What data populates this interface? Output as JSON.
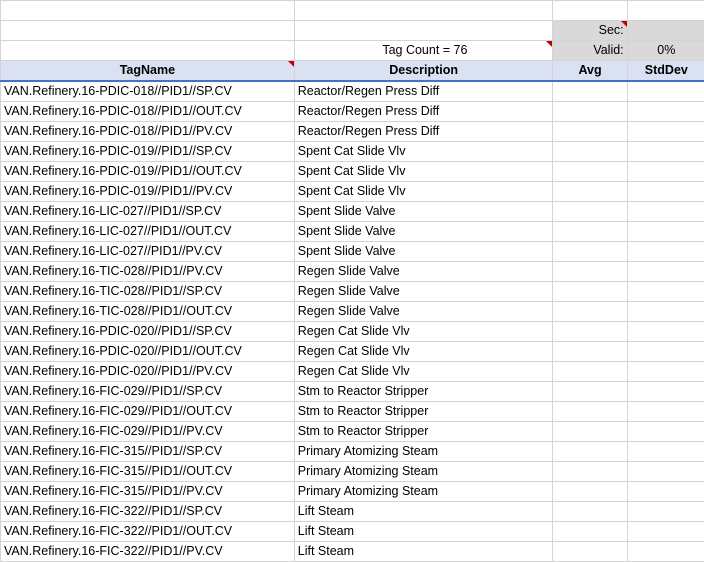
{
  "header": {
    "sec_label": "Sec:",
    "sec_value": "",
    "tag_count": "Tag Count = 76",
    "valid_label": "Valid:",
    "valid_value": "0%"
  },
  "columns": [
    "TagName",
    "Description",
    "Avg",
    "StdDev"
  ],
  "rows": [
    [
      "VAN.Refinery.16-PDIC-018//PID1//SP.CV",
      "Reactor/Regen Press Diff"
    ],
    [
      "VAN.Refinery.16-PDIC-018//PID1//OUT.CV",
      "Reactor/Regen Press Diff"
    ],
    [
      "VAN.Refinery.16-PDIC-018//PID1//PV.CV",
      "Reactor/Regen Press Diff"
    ],
    [
      "VAN.Refinery.16-PDIC-019//PID1//SP.CV",
      "Spent Cat Slide Vlv"
    ],
    [
      "VAN.Refinery.16-PDIC-019//PID1//OUT.CV",
      "Spent Cat Slide Vlv"
    ],
    [
      "VAN.Refinery.16-PDIC-019//PID1//PV.CV",
      "Spent Cat Slide Vlv"
    ],
    [
      "VAN.Refinery.16-LIC-027//PID1//SP.CV",
      "Spent Slide Valve"
    ],
    [
      "VAN.Refinery.16-LIC-027//PID1//OUT.CV",
      "Spent Slide Valve"
    ],
    [
      "VAN.Refinery.16-LIC-027//PID1//PV.CV",
      "Spent Slide Valve"
    ],
    [
      "VAN.Refinery.16-TIC-028//PID1//PV.CV",
      "Regen Slide Valve"
    ],
    [
      "VAN.Refinery.16-TIC-028//PID1//SP.CV",
      "Regen Slide Valve"
    ],
    [
      "VAN.Refinery.16-TIC-028//PID1//OUT.CV",
      "Regen Slide Valve"
    ],
    [
      "VAN.Refinery.16-PDIC-020//PID1//SP.CV",
      "Regen Cat Slide Vlv"
    ],
    [
      "VAN.Refinery.16-PDIC-020//PID1//OUT.CV",
      "Regen Cat Slide Vlv"
    ],
    [
      "VAN.Refinery.16-PDIC-020//PID1//PV.CV",
      "Regen Cat Slide Vlv"
    ],
    [
      "VAN.Refinery.16-FIC-029//PID1//SP.CV",
      "Stm to Reactor Stripper"
    ],
    [
      "VAN.Refinery.16-FIC-029//PID1//OUT.CV",
      "Stm to Reactor Stripper"
    ],
    [
      "VAN.Refinery.16-FIC-029//PID1//PV.CV",
      "Stm to Reactor Stripper"
    ],
    [
      "VAN.Refinery.16-FIC-315//PID1//SP.CV",
      "Primary Atomizing Steam"
    ],
    [
      "VAN.Refinery.16-FIC-315//PID1//OUT.CV",
      "Primary Atomizing Steam"
    ],
    [
      "VAN.Refinery.16-FIC-315//PID1//PV.CV",
      "Primary Atomizing Steam"
    ],
    [
      "VAN.Refinery.16-FIC-322//PID1//SP.CV",
      "Lift Steam"
    ],
    [
      "VAN.Refinery.16-FIC-322//PID1//OUT.CV",
      "Lift Steam"
    ],
    [
      "VAN.Refinery.16-FIC-322//PID1//PV.CV",
      "Lift Steam"
    ]
  ]
}
